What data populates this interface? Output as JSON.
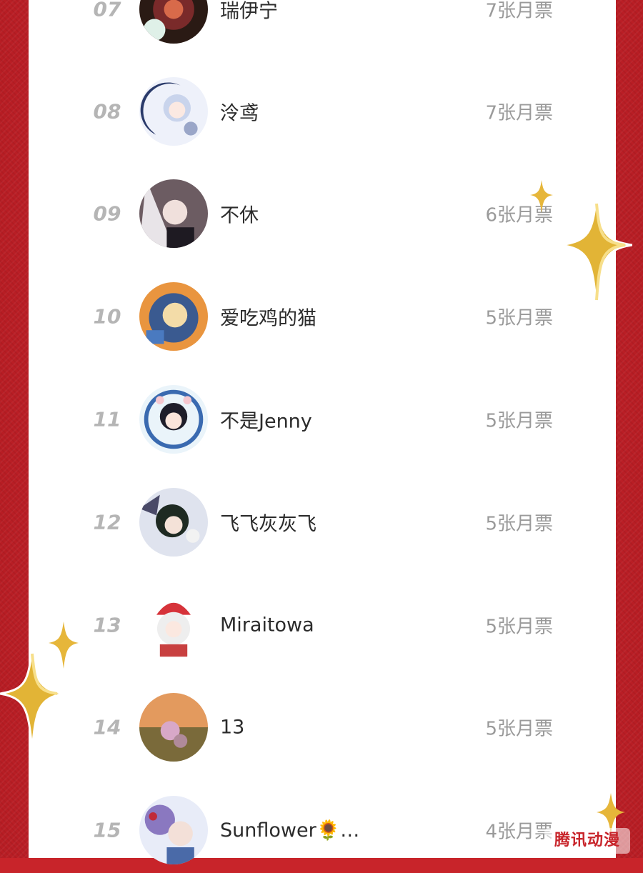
{
  "list": {
    "entries": [
      {
        "rank": "07",
        "name": "瑞伊宁",
        "votes": "7张月票",
        "avatar_color": "#5a3a2a"
      },
      {
        "rank": "08",
        "name": "泠鸢",
        "votes": "7张月票",
        "avatar_color": "#c9d4ec"
      },
      {
        "rank": "09",
        "name": "不休",
        "votes": "6张月票",
        "avatar_color": "#7a6a70"
      },
      {
        "rank": "10",
        "name": "爱吃鸡的猫",
        "votes": "5张月票",
        "avatar_color": "#e8a050"
      },
      {
        "rank": "11",
        "name": "不是Jenny",
        "votes": "5张月票",
        "avatar_color": "#3a5a8a"
      },
      {
        "rank": "12",
        "name": "飞飞灰灰飞",
        "votes": "5张月票",
        "avatar_color": "#4a4a68"
      },
      {
        "rank": "13",
        "name": "Miraitowa",
        "votes": "5张月票",
        "avatar_color": "#f2e8e4"
      },
      {
        "rank": "14",
        "name": "13",
        "votes": "5张月票",
        "avatar_color": "#c9855a"
      },
      {
        "rank": "15",
        "name": "Sunflower🌻…",
        "votes": "4张月票",
        "avatar_color": "#8a78c0"
      }
    ]
  },
  "watermark": {
    "text": "腾讯动漫"
  },
  "colors": {
    "background_red": "#c8242a",
    "panel": "#ffffff",
    "sparkle_gold": "#e0b030"
  }
}
